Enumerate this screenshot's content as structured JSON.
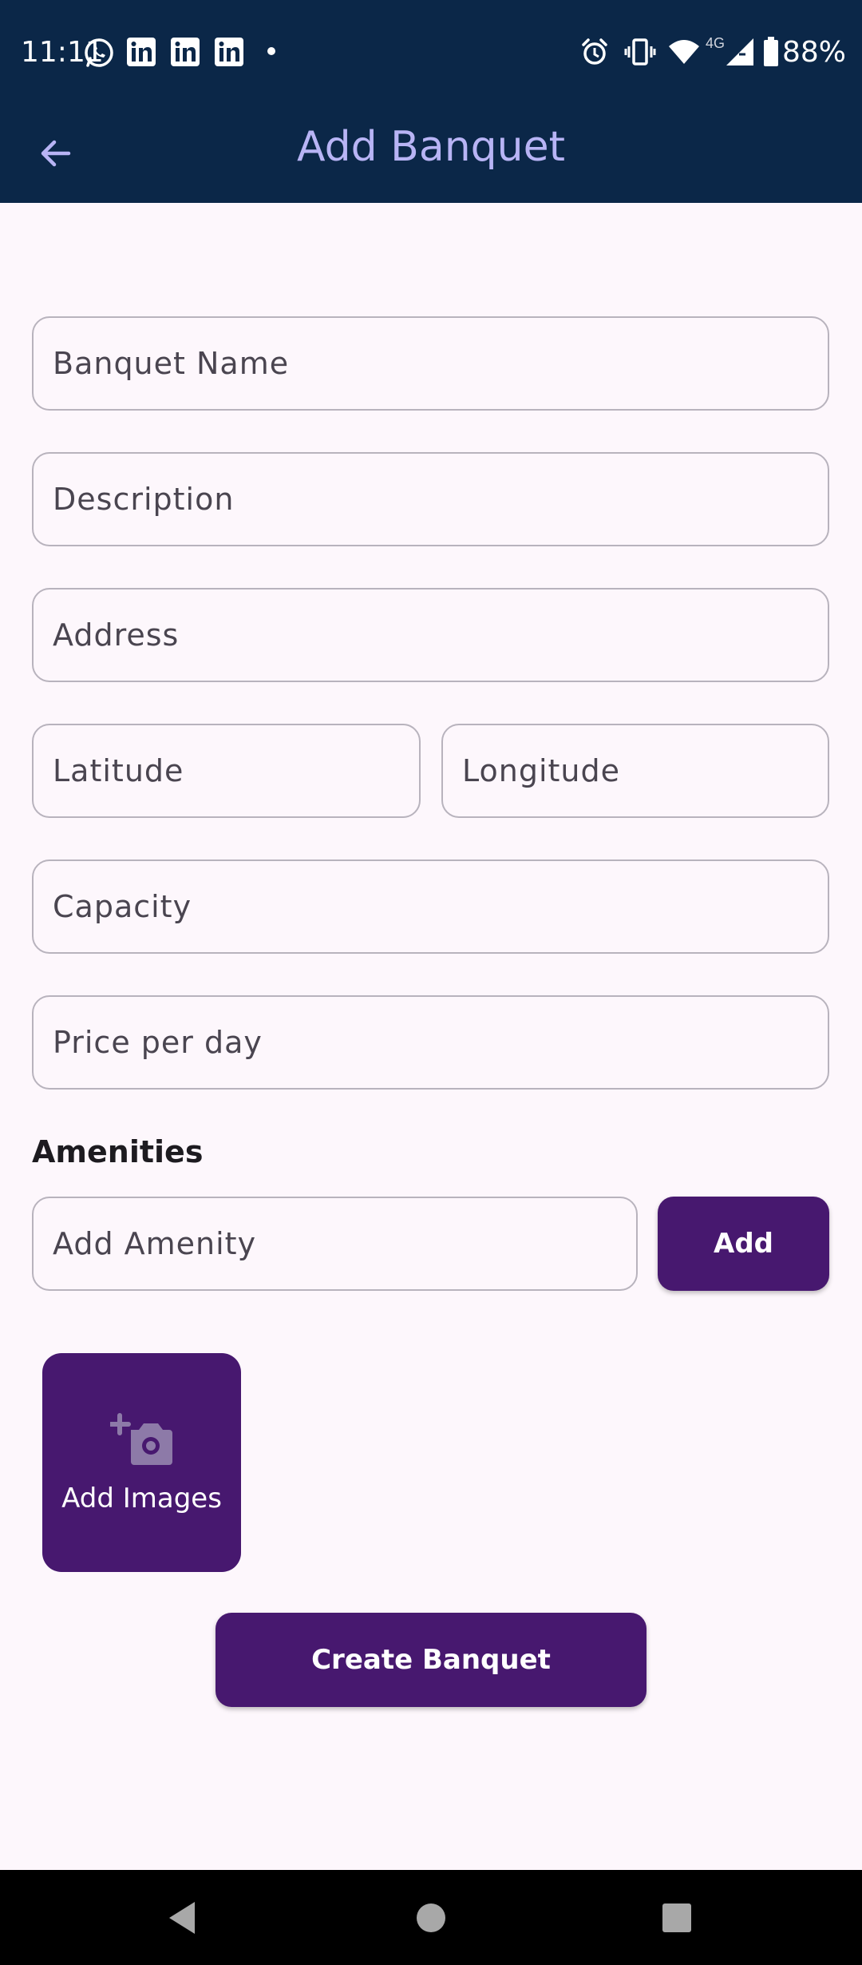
{
  "status_bar": {
    "time": "11:11",
    "battery": "88%",
    "network": "4G",
    "icons": [
      "whatsapp-icon",
      "linkedin-icon",
      "linkedin-icon",
      "linkedin-icon",
      "dot-icon",
      "alarm-icon",
      "vibrate-icon",
      "wifi-icon",
      "signal-icon",
      "battery-icon"
    ]
  },
  "app_bar": {
    "title": "Add Banquet",
    "back_icon": "arrow-left-icon",
    "background": "#0b2748",
    "title_color": "#b8b4f5"
  },
  "form": {
    "banquet_name": {
      "placeholder": "Banquet Name",
      "value": ""
    },
    "description": {
      "placeholder": "Description",
      "value": ""
    },
    "address": {
      "placeholder": "Address",
      "value": ""
    },
    "latitude": {
      "placeholder": "Latitude",
      "value": ""
    },
    "longitude": {
      "placeholder": "Longitude",
      "value": ""
    },
    "capacity": {
      "placeholder": "Capacity",
      "value": ""
    },
    "price_per_day": {
      "placeholder": "Price per day",
      "value": ""
    }
  },
  "amenities": {
    "label": "Amenities",
    "input_placeholder": "Add Amenity",
    "add_button": "Add"
  },
  "images": {
    "label": "Add Images",
    "icon": "add-photo-icon"
  },
  "create_button": "Create Banquet",
  "colors": {
    "accent": "#47186f",
    "background": "#fdf7fc"
  }
}
